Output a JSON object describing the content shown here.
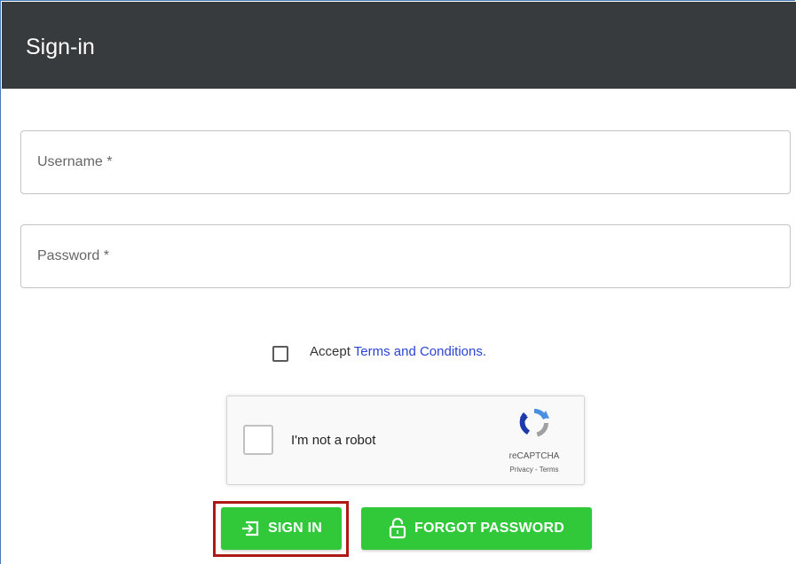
{
  "header": {
    "title": "Sign-in"
  },
  "form": {
    "username_label": "Username *",
    "password_label": "Password *",
    "terms": {
      "prefix": "Accept ",
      "link_text": "Terms and Conditions."
    },
    "recaptcha": {
      "label": "I'm not a robot",
      "brand": "reCAPTCHA",
      "links": "Privacy - Terms",
      "logo_icon": "recaptcha-logo-icon"
    },
    "buttons": {
      "sign_in": "SIGN IN",
      "sign_in_icon": "login-icon",
      "forgot_password": "FORGOT PASSWORD",
      "forgot_icon": "lock-open-icon"
    }
  },
  "colors": {
    "header_bg": "#373b3e",
    "button_green": "#31c93a",
    "link_blue": "#2a44d6",
    "highlight_red": "#b01818"
  }
}
